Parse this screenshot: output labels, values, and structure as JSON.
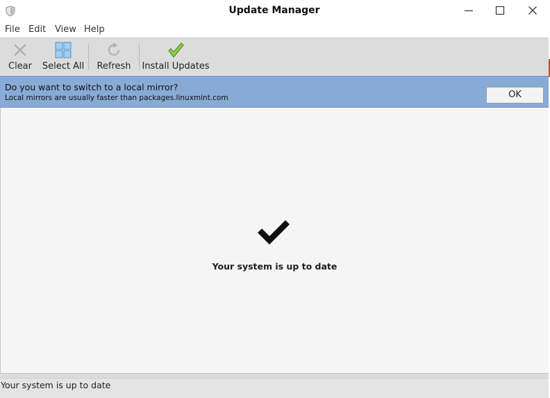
{
  "window": {
    "title": "Update Manager",
    "controls": {
      "minimize": "minimize",
      "maximize": "maximize",
      "close": "close"
    }
  },
  "menu": {
    "items": [
      "File",
      "Edit",
      "View",
      "Help"
    ]
  },
  "toolbar": {
    "buttons": [
      {
        "label": "Clear",
        "icon": "clear-x-icon",
        "enabled": false
      },
      {
        "label": "Select All",
        "icon": "select-all-grid-icon",
        "enabled": true
      },
      {
        "label": "Refresh",
        "icon": "refresh-icon",
        "enabled": false
      },
      {
        "label": "Install Updates",
        "icon": "install-check-icon",
        "enabled": true
      }
    ]
  },
  "infobar": {
    "question": "Do you want to switch to a local mirror?",
    "detail": "Local mirrors are usually faster than packages.linuxmint.com",
    "ok_label": "OK",
    "color": "#88abd6"
  },
  "content": {
    "status_icon": "checkmark-icon",
    "message": "Your system is up to date"
  },
  "statusbar": {
    "text": "Your system is up to date"
  }
}
